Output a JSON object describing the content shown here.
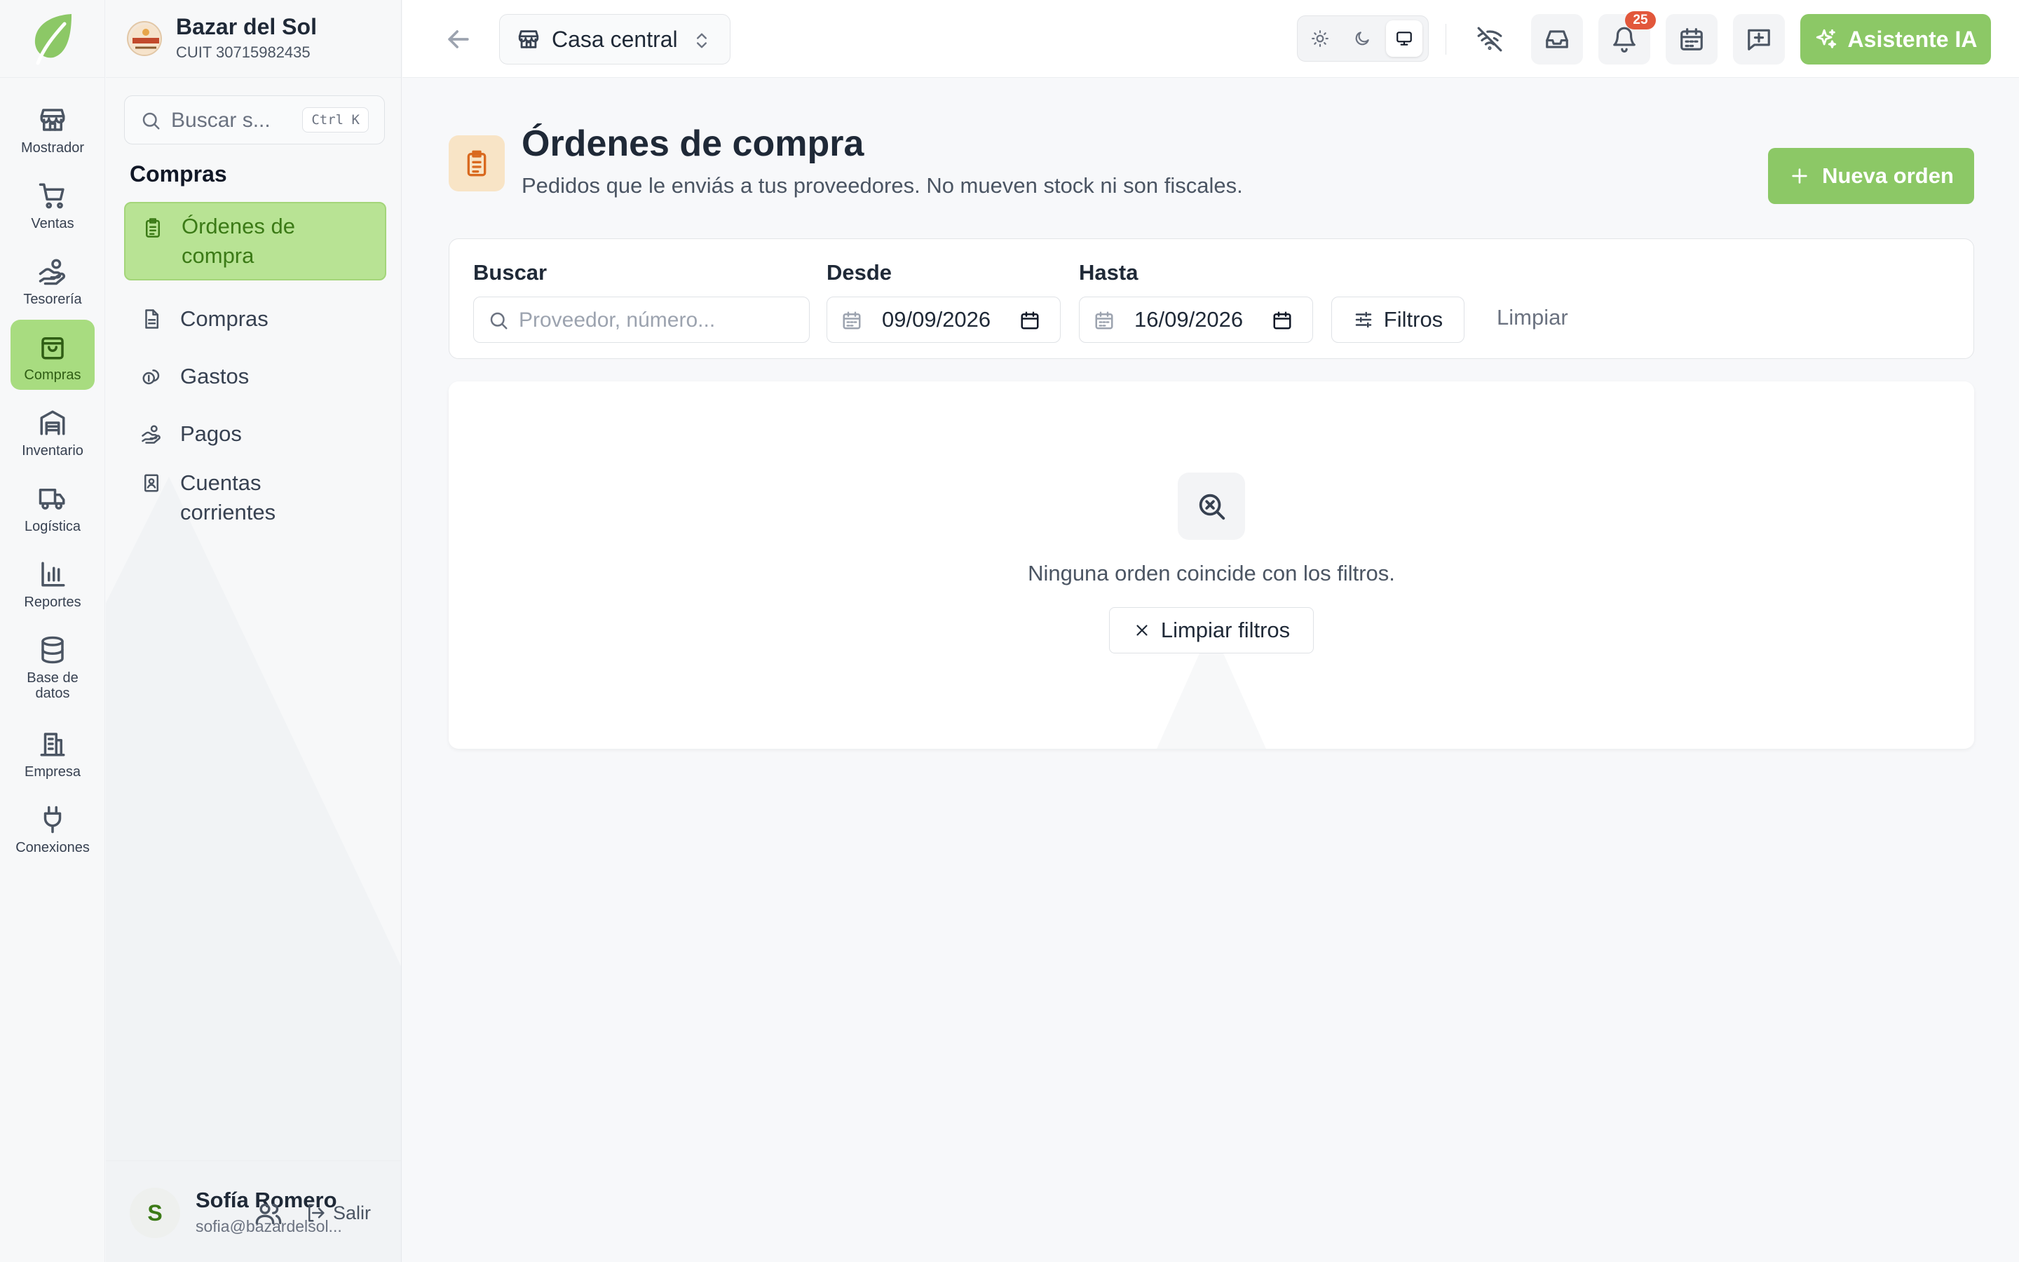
{
  "rail": {
    "items": [
      {
        "label": "Mostrador",
        "icon": "store-icon"
      },
      {
        "label": "Ventas",
        "icon": "cart-icon"
      },
      {
        "label": "Tesorería",
        "icon": "hand-coins-icon"
      },
      {
        "label": "Compras",
        "icon": "shopping-bag-icon",
        "active": true
      },
      {
        "label": "Inventario",
        "icon": "warehouse-icon"
      },
      {
        "label": "Logística",
        "icon": "truck-icon"
      },
      {
        "label": "Reportes",
        "icon": "bar-chart-icon"
      },
      {
        "label": "Base de datos",
        "icon": "database-icon"
      },
      {
        "label": "Empresa",
        "icon": "building-icon"
      },
      {
        "label": "Conexiones",
        "icon": "plug-icon"
      }
    ]
  },
  "company": {
    "name": "Bazar del Sol",
    "cuit": "CUIT 30715982435"
  },
  "sidebar": {
    "search_placeholder": "Buscar s...",
    "shortcut": "Ctrl K",
    "section_title": "Compras",
    "items": [
      {
        "label": "Órdenes de compra",
        "icon": "clipboard-list-icon",
        "active": true
      },
      {
        "label": "Compras",
        "icon": "file-text-icon"
      },
      {
        "label": "Gastos",
        "icon": "coins-icon"
      },
      {
        "label": "Pagos",
        "icon": "hand-coins-icon"
      },
      {
        "label": "Cuentas corrientes",
        "icon": "contact-book-icon"
      }
    ]
  },
  "user": {
    "initial": "S",
    "name": "Sofía Romero",
    "email": "sofia@bazardelsol...",
    "logout_label": "Salir"
  },
  "topbar": {
    "branch": "Casa central",
    "notifications_count": "25",
    "ai_label": "Asistente IA"
  },
  "page": {
    "title": "Órdenes de compra",
    "subtitle": "Pedidos que le enviás a tus proveedores. No mueven stock ni son fiscales.",
    "new_button": "Nueva orden"
  },
  "filters": {
    "search_label": "Buscar",
    "search_placeholder": "Proveedor, número...",
    "from_label": "Desde",
    "from_value": "09/09/2026",
    "to_label": "Hasta",
    "to_value": "16/09/2026",
    "filters_button": "Filtros",
    "clear_link": "Limpiar"
  },
  "empty_state": {
    "message": "Ninguna orden coincide con los filtros.",
    "clear_button": "Limpiar filtros"
  },
  "colors": {
    "accent": "#8cc866",
    "accent_active_bg": "#a8dc80",
    "badge": "#e2573b",
    "page_icon_bg": "#f8e4c6"
  }
}
